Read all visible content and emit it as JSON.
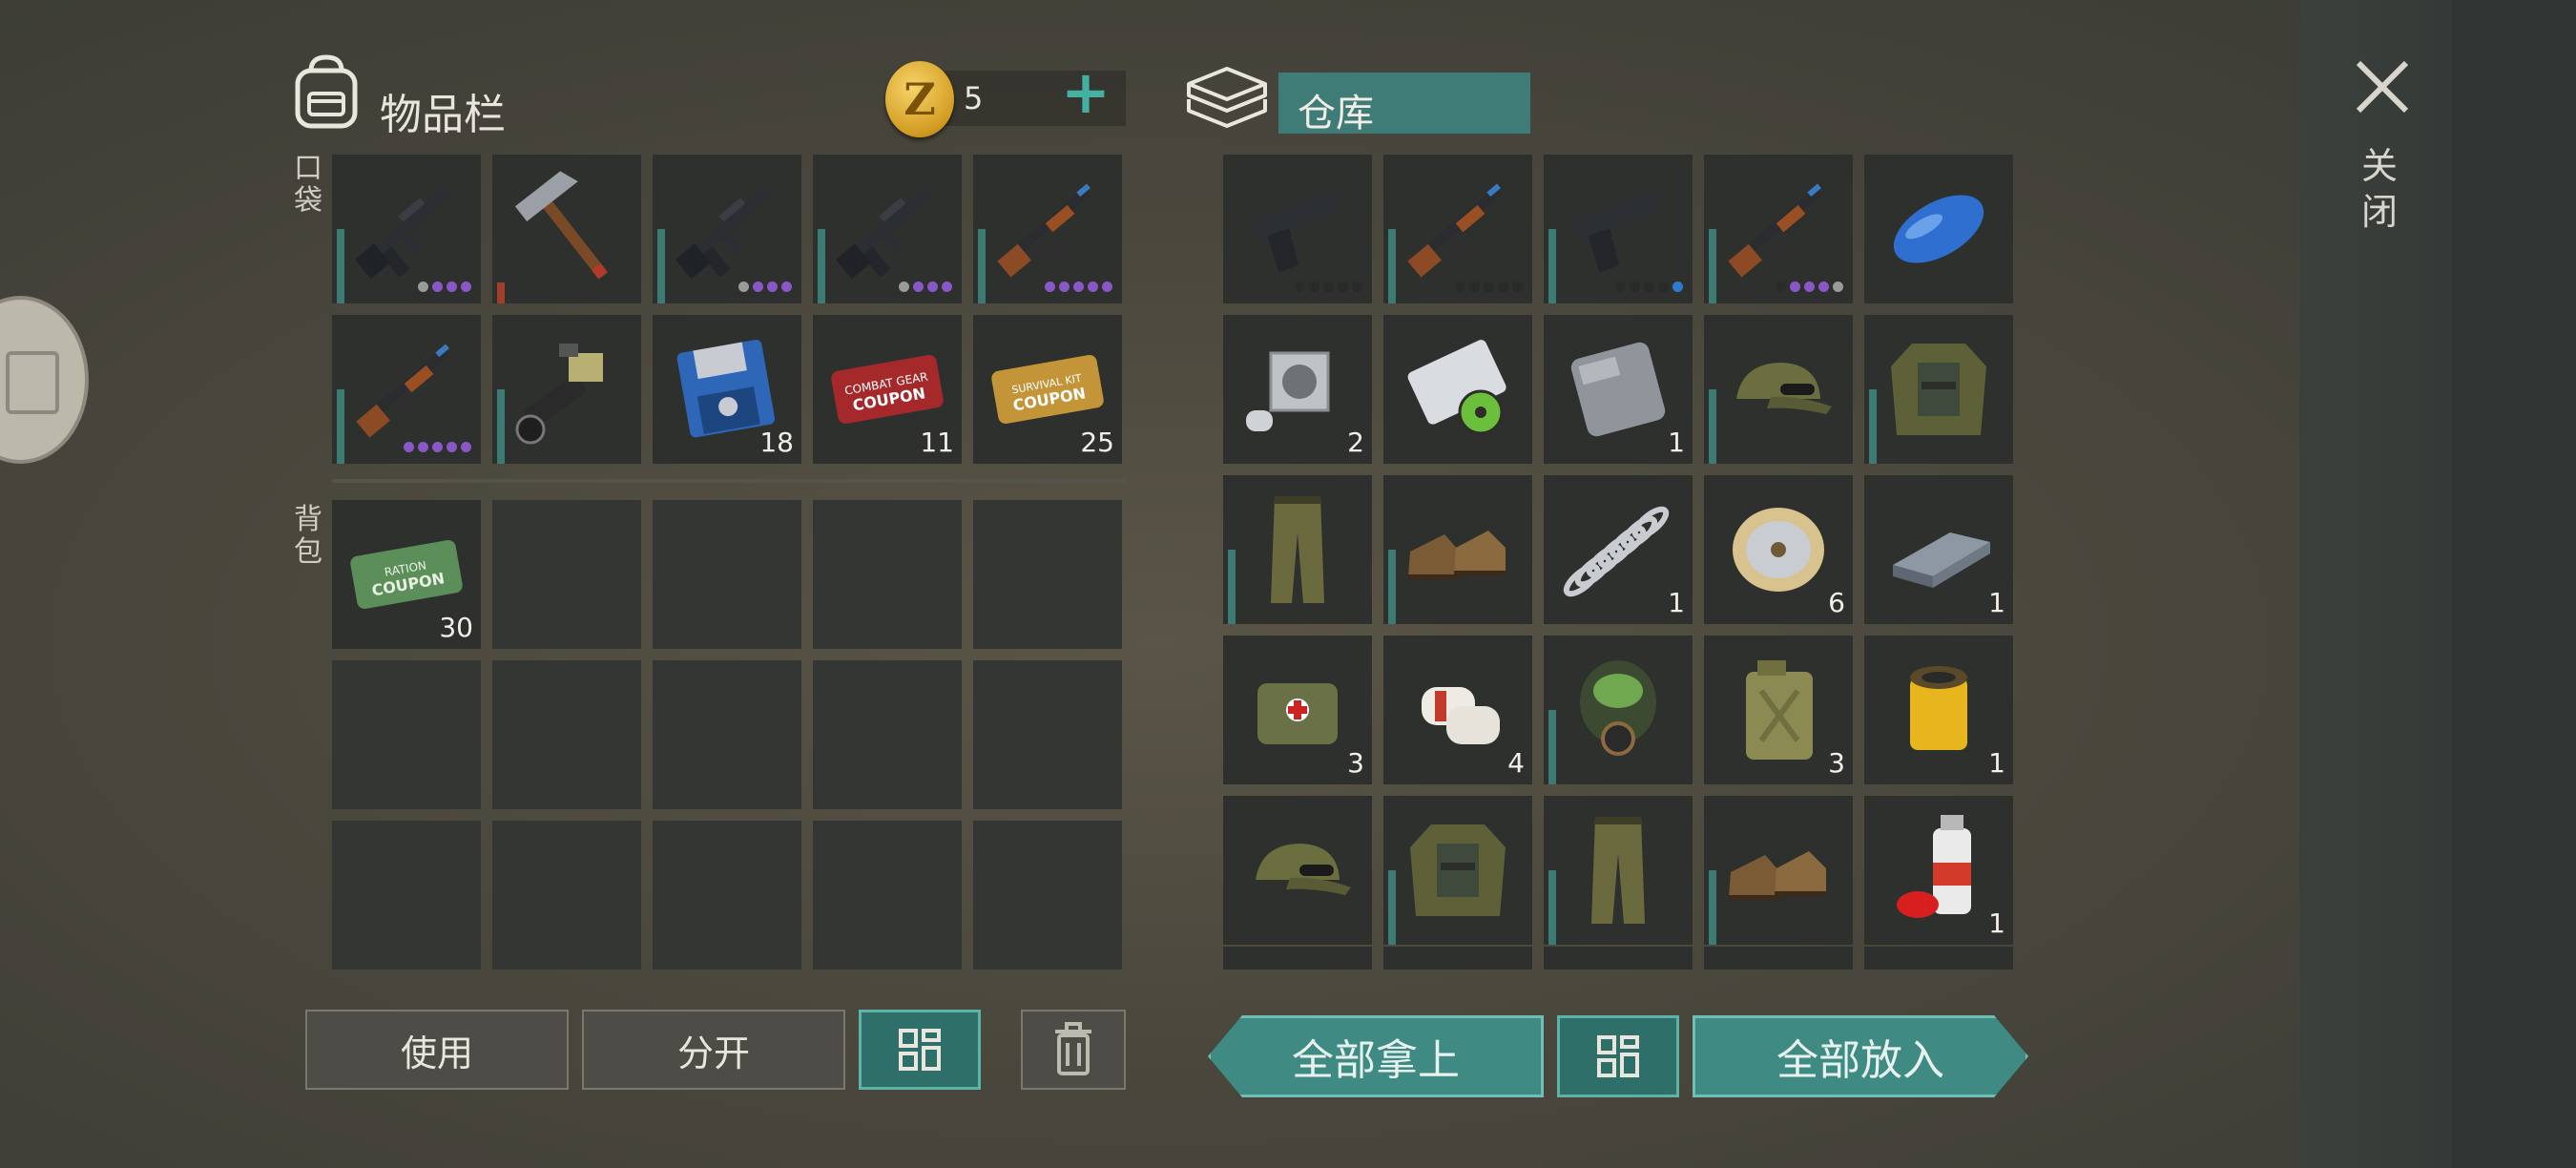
{
  "inventory": {
    "title": "物品栏",
    "coins": "5",
    "pocket_label": "口袋",
    "backpack_label": "背包",
    "pocket_slots": [
      {
        "item": "m16-rifle",
        "bar": "teal",
        "dots": [
          "g",
          "p",
          "p",
          "p"
        ]
      },
      {
        "item": "hatchet",
        "bar": "red"
      },
      {
        "item": "m16-rifle",
        "bar": "teal",
        "dots": [
          "g",
          "p",
          "p",
          "p"
        ]
      },
      {
        "item": "m16-rifle",
        "bar": "teal",
        "dots": [
          "g",
          "p",
          "p",
          "p"
        ]
      },
      {
        "item": "ak-rifle",
        "bar": "teal",
        "dots": [
          "p",
          "p",
          "p",
          "p",
          "p"
        ]
      },
      {
        "item": "ak-rifle",
        "bar": "teal",
        "dots": [
          "p",
          "p",
          "p",
          "p",
          "p"
        ]
      },
      {
        "item": "flamethrower",
        "bar": "teal"
      },
      {
        "item": "floppy-disk",
        "count": "18"
      },
      {
        "item": "combat-gear-coupon",
        "count": "11"
      },
      {
        "item": "survival-kit-coupon",
        "count": "25"
      }
    ],
    "backpack_slots": [
      {
        "item": "ration-coupon",
        "count": "30"
      }
    ]
  },
  "warehouse": {
    "title": "仓库",
    "slots": [
      {
        "item": "pistol",
        "dots": [
          "k",
          "k",
          "k",
          "k",
          "k"
        ]
      },
      {
        "item": "ak-rifle",
        "bar": "teal",
        "dots": [
          "k",
          "k",
          "k",
          "k",
          "k"
        ]
      },
      {
        "item": "pistol",
        "bar": "teal",
        "dots": [
          "k",
          "k",
          "k",
          "k",
          "b"
        ]
      },
      {
        "item": "ak-rifle",
        "bar": "teal",
        "dots": [
          "k",
          "p",
          "p",
          "p",
          "g"
        ]
      },
      {
        "item": "gas-tank"
      },
      {
        "item": "engine-cylinder",
        "count": "2"
      },
      {
        "item": "biohazard-blueprints"
      },
      {
        "item": "metal-sheet",
        "count": "1"
      },
      {
        "item": "camo-cap",
        "bar": "teal"
      },
      {
        "item": "camo-jacket",
        "bar": "teal"
      },
      {
        "item": "camo-pants",
        "bar": "teal"
      },
      {
        "item": "boots",
        "bar": "teal"
      },
      {
        "item": "spring",
        "count": "1"
      },
      {
        "item": "wire-spool",
        "count": "6"
      },
      {
        "item": "steel-ingot",
        "count": "1"
      },
      {
        "item": "medkit-bag",
        "count": "3"
      },
      {
        "item": "bandage",
        "count": "4"
      },
      {
        "item": "gas-mask",
        "bar": "teal"
      },
      {
        "item": "jerrycan",
        "count": "3"
      },
      {
        "item": "oil-filter",
        "count": "1"
      },
      {
        "item": "camo-cap"
      },
      {
        "item": "camo-jacket",
        "bar": "teal"
      },
      {
        "item": "camo-pants",
        "bar": "teal"
      },
      {
        "item": "boots",
        "bar": "teal"
      },
      {
        "item": "spray-paint",
        "count": "1"
      }
    ]
  },
  "buttons": {
    "use": "使用",
    "split": "分开",
    "take_all": "全部拿上",
    "put_all": "全部放入",
    "close": "关闭"
  },
  "colors": {
    "accent": "#3f8b83",
    "slot_bg": "#2d302c",
    "rarity_purple": "#8a57c9",
    "durability_red": "#a33d2c"
  }
}
